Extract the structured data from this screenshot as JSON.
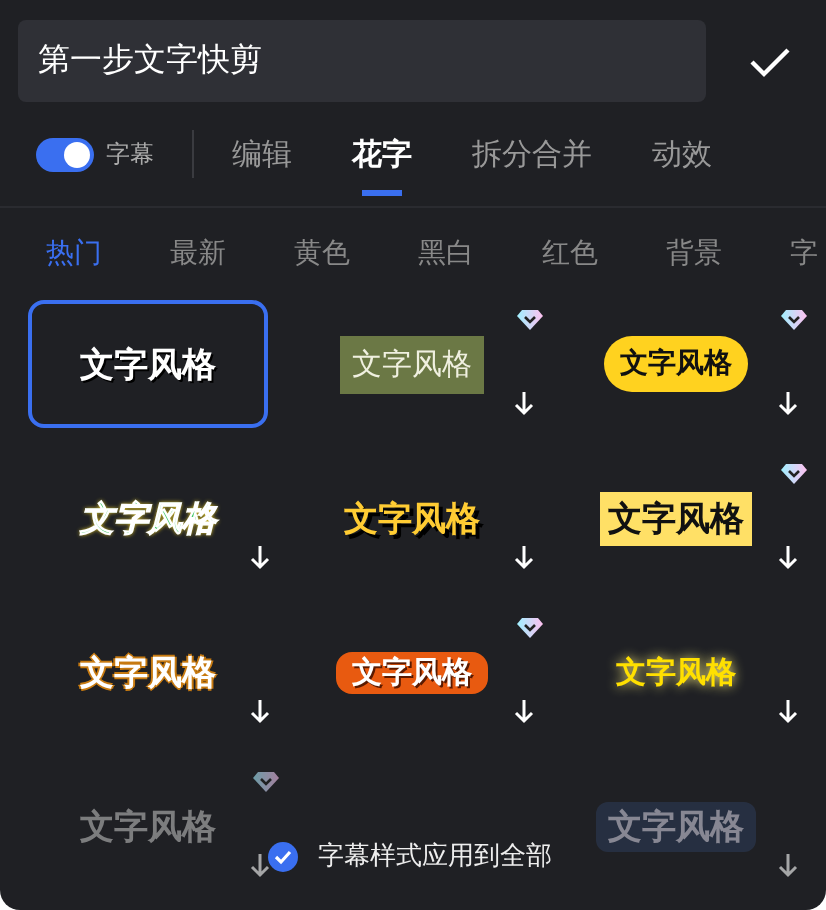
{
  "text_field": {
    "value": "第一步文字快剪"
  },
  "subtitle_toggle": {
    "label": "字幕",
    "on": true
  },
  "tabs": [
    {
      "label": "编辑",
      "selected": false
    },
    {
      "label": "花字",
      "selected": true
    },
    {
      "label": "拆分合并",
      "selected": false
    },
    {
      "label": "动效",
      "selected": false
    }
  ],
  "categories": [
    {
      "label": "热门",
      "selected": true
    },
    {
      "label": "最新",
      "selected": false
    },
    {
      "label": "黄色",
      "selected": false
    },
    {
      "label": "黑白",
      "selected": false
    },
    {
      "label": "红色",
      "selected": false
    },
    {
      "label": "背景",
      "selected": false
    },
    {
      "label": "字",
      "selected": false
    }
  ],
  "styles": [
    {
      "kind": "plain",
      "text": "文字风格",
      "selected": true,
      "premium": false,
      "downloaded": true
    },
    {
      "kind": "olive",
      "text": "文字风格",
      "selected": false,
      "premium": true,
      "downloaded": false
    },
    {
      "kind": "pill",
      "text": "文字风格",
      "selected": false,
      "premium": true,
      "downloaded": false
    },
    {
      "kind": "rainbow",
      "text": "文字风格",
      "selected": false,
      "premium": false,
      "downloaded": false
    },
    {
      "kind": "shadow",
      "text": "文字风格",
      "selected": false,
      "premium": false,
      "downloaded": false
    },
    {
      "kind": "box",
      "text": "文字风格",
      "selected": false,
      "premium": true,
      "downloaded": false
    },
    {
      "kind": "outline",
      "text": "文字风格",
      "selected": false,
      "premium": false,
      "downloaded": false
    },
    {
      "kind": "orange",
      "text": "文字风格",
      "selected": false,
      "premium": true,
      "downloaded": false
    },
    {
      "kind": "glow",
      "text": "文字风格",
      "selected": false,
      "premium": false,
      "downloaded": false
    },
    {
      "kind": "dark",
      "text": "文字风格",
      "selected": false,
      "premium": true,
      "downloaded": false
    },
    {
      "kind": "bluepill",
      "text": "文字风格",
      "selected": false,
      "premium": false,
      "downloaded": false
    }
  ],
  "apply_all": {
    "label": "字幕样式应用到全部",
    "checked": true
  }
}
